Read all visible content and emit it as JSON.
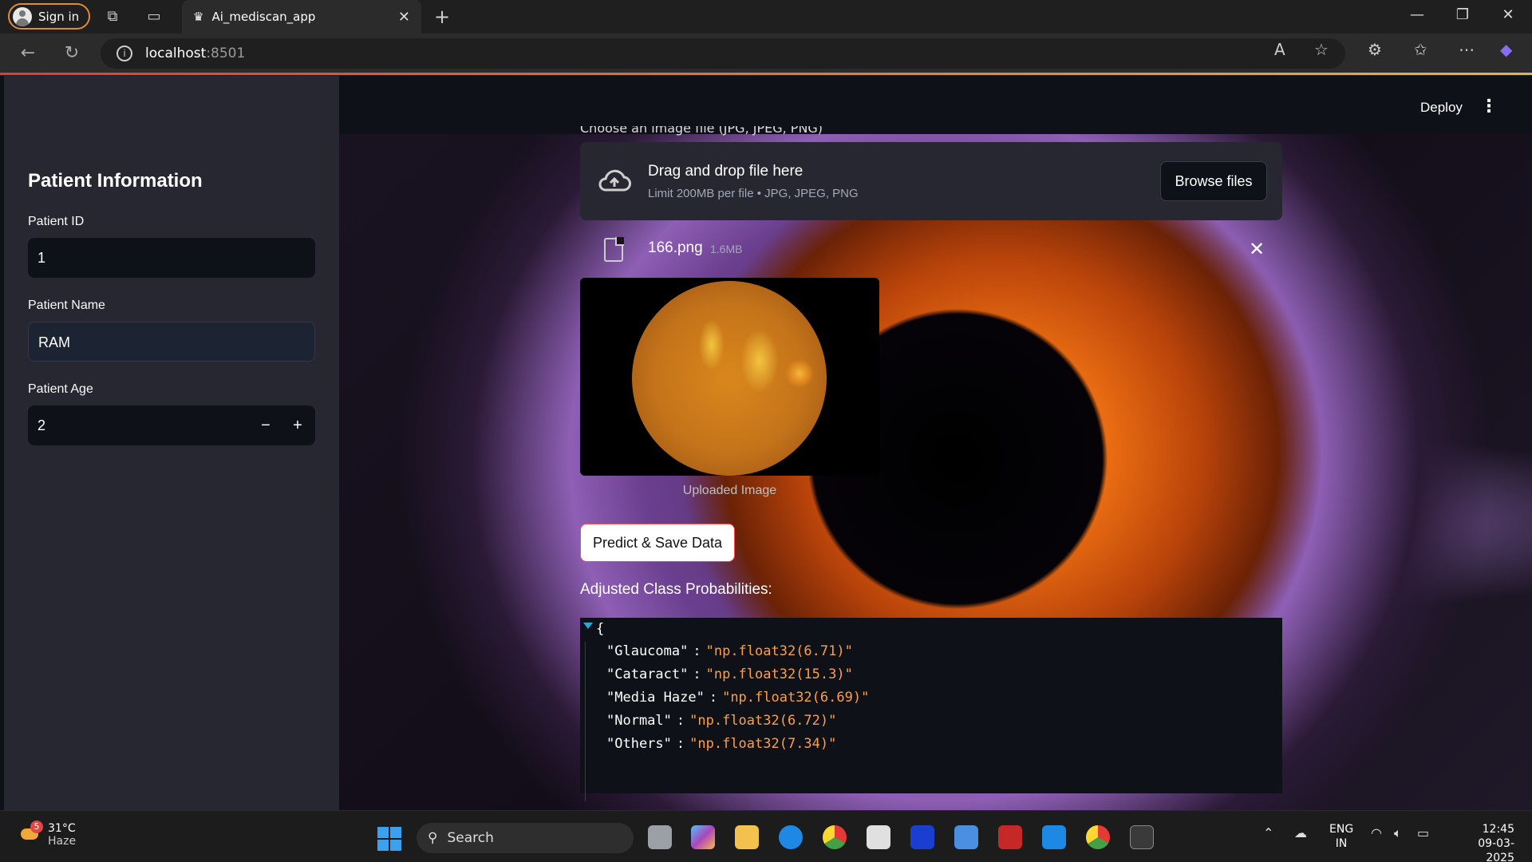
{
  "browser": {
    "signin_label": "Sign in",
    "tab_title": "Ai_mediscan_app",
    "url_host": "localhost",
    "url_port": ":8501"
  },
  "sidebar": {
    "title": "Patient Information",
    "patient_id_label": "Patient ID",
    "patient_id_value": "1",
    "patient_name_label": "Patient Name",
    "patient_name_value": "RAM",
    "patient_age_label": "Patient Age",
    "patient_age_value": "2",
    "minus": "−",
    "plus": "+"
  },
  "header": {
    "deploy_label": "Deploy",
    "menu_glyph": "⋮"
  },
  "uploader": {
    "label_partial": "Choose an image file (JPG, JPEG, PNG)",
    "drop_title": "Drag and drop file here",
    "drop_sub": "Limit 200MB per file • JPG, JPEG, PNG",
    "browse_label": "Browse files",
    "file_name": "166.png",
    "file_size": "1.6MB",
    "remove_glyph": "✕"
  },
  "image": {
    "caption": "Uploaded Image"
  },
  "predict_label": "Predict & Save Data",
  "probabilities": {
    "title": "Adjusted Class Probabilities:",
    "open_brace": "{",
    "items": [
      {
        "key": "\"Glaucoma\"",
        "value": "\"np.float32(6.71)\""
      },
      {
        "key": "\"Cataract\"",
        "value": "\"np.float32(15.3)\""
      },
      {
        "key": "\"Media Haze\"",
        "value": "\"np.float32(6.69)\""
      },
      {
        "key": "\"Normal\"",
        "value": "\"np.float32(6.72)\""
      },
      {
        "key": "\"Others\"",
        "value": "\"np.float32(7.34)\""
      }
    ],
    "colon": ":"
  },
  "taskbar": {
    "weather_temp": "31°C",
    "weather_desc": "Haze",
    "weather_badge": "5",
    "search_label": "Search",
    "lang_top": "ENG",
    "lang_bottom": "IN",
    "time": "12:45",
    "date": "09-03-2025"
  },
  "colors": {
    "accent": "#ff4b4b",
    "json_value": "#ff9f43",
    "app_bg": "#0e1117",
    "sidebar_bg": "#262730"
  }
}
